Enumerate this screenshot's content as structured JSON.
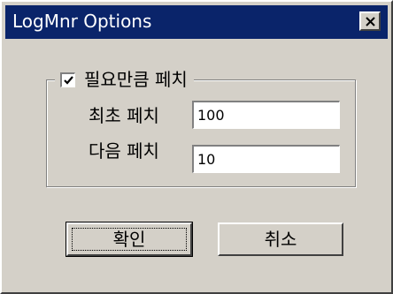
{
  "window": {
    "title": "LogMnr Options",
    "close_icon": "close-icon"
  },
  "group": {
    "checkbox_label": "필요만큼 페치",
    "checked": true
  },
  "fields": {
    "initial_fetch": {
      "label": "최초 페치",
      "value": "100"
    },
    "next_fetch": {
      "label": "다음 페치",
      "value": "10"
    }
  },
  "buttons": {
    "ok_label": "확인",
    "cancel_label": "취소"
  },
  "colors": {
    "dialog_bg": "#d4d0c8",
    "titlebar_bg": "#0a246a",
    "titlebar_text": "#ffffff",
    "field_bg": "#ffffff"
  }
}
